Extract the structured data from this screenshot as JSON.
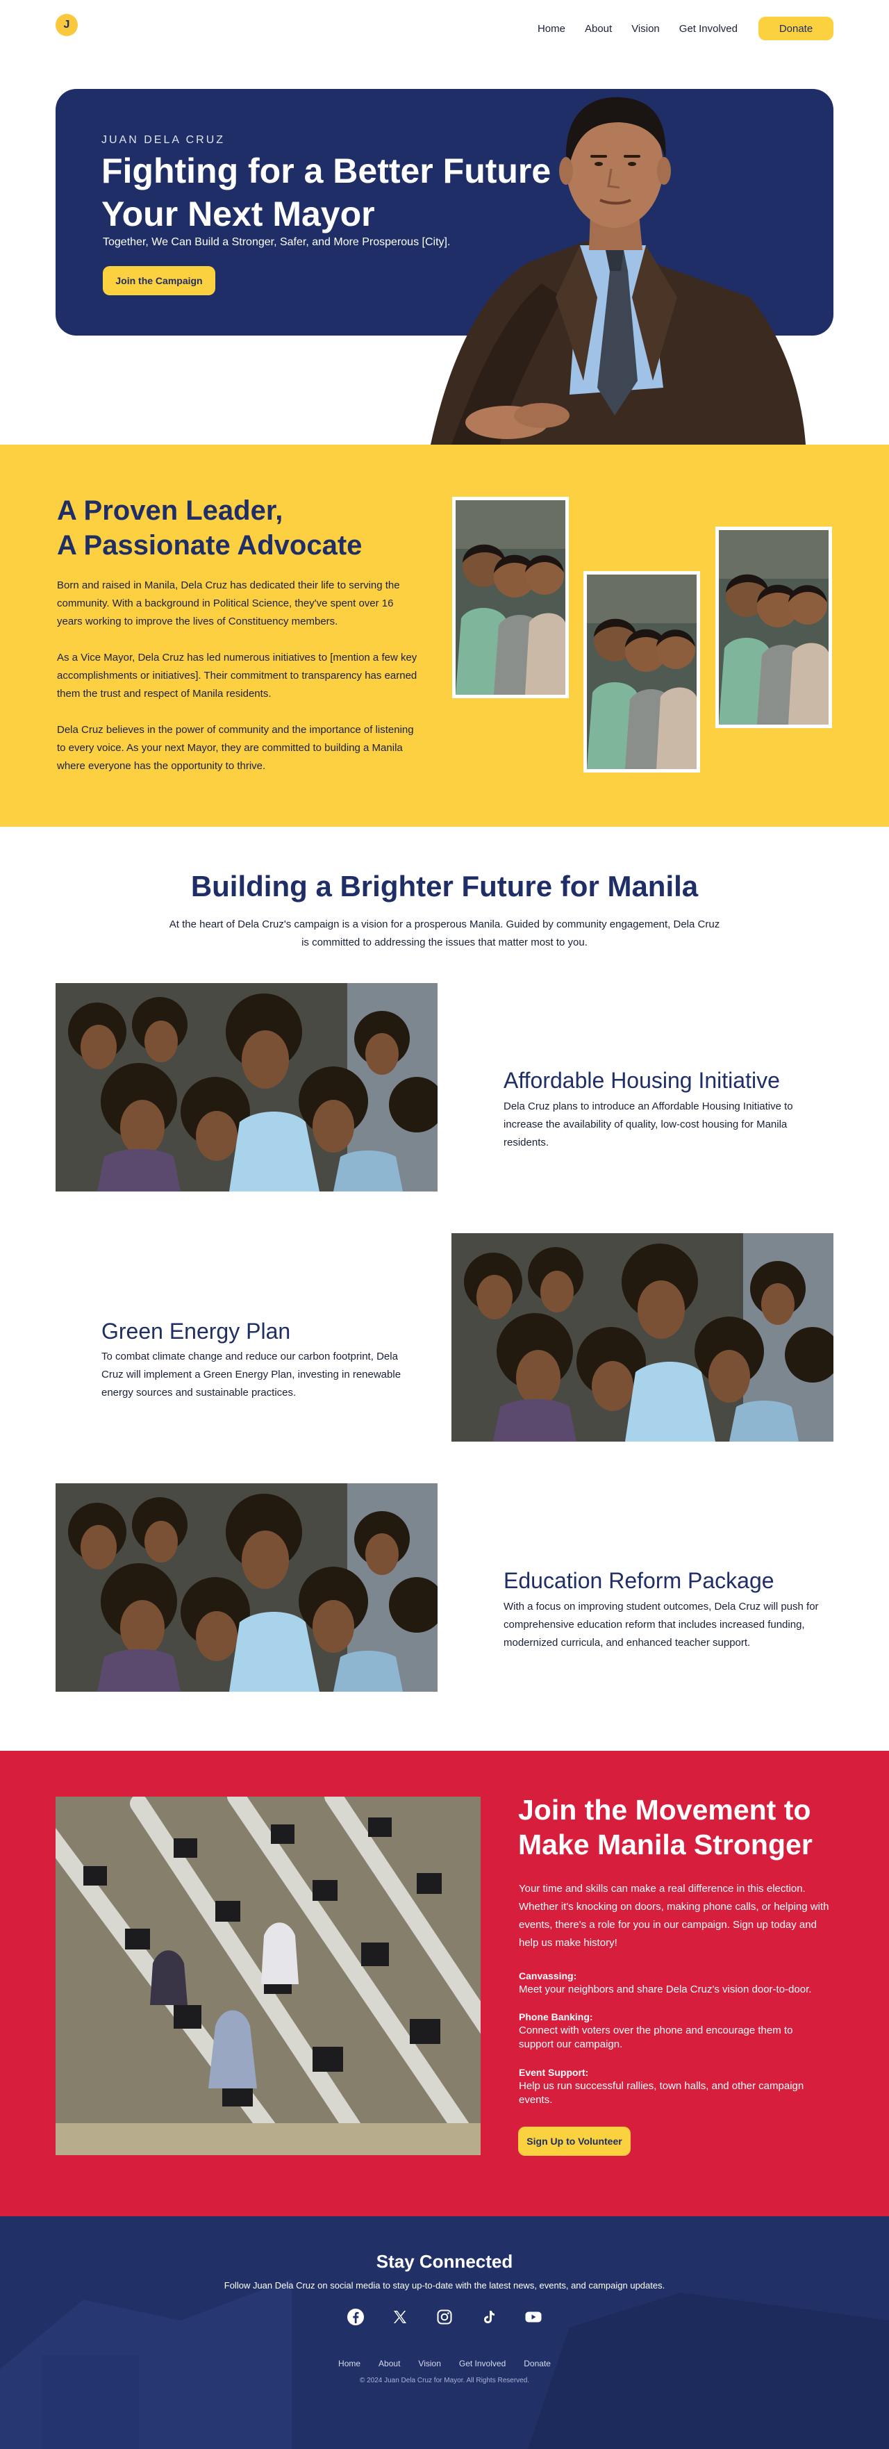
{
  "colors": {
    "navy": "#1f2e66",
    "yellow": "#fcd040",
    "red": "#d81e3d",
    "white": "#ffffff"
  },
  "nav": {
    "logo_letter": "J",
    "links": [
      "Home",
      "About",
      "Vision",
      "Get Involved"
    ],
    "donate_label": "Donate"
  },
  "hero": {
    "kicker": "JUAN DELA CRUZ",
    "title": "Fighting for a Better Future as Your Next Mayor",
    "subtitle": "Together, We Can Build a Stronger, Safer, and More Prosperous [City].",
    "cta_label": "Join the Campaign"
  },
  "about": {
    "title_line1": "A Proven Leader,",
    "title_line2": "A Passionate Advocate",
    "paragraphs": [
      "Born and raised in Manila, Dela Cruz has dedicated their life to serving the community. With a background in Political Science, they've spent over 16 years working to improve the lives of Constituency members.",
      "As a Vice Mayor, Dela Cruz has led numerous initiatives to [mention a few key accomplishments or initiatives]. Their commitment to transparency has earned them the trust and respect of Manila residents.",
      "Dela Cruz believes in the power of community and the importance of listening to every voice. As your next Mayor, they are committed to building a Manila where everyone has the opportunity to thrive."
    ]
  },
  "vision": {
    "title": "Building a Brighter Future for Manila",
    "intro": "At the heart of Dela Cruz's campaign is a vision for a prosperous Manila. Guided by community engagement, Dela Cruz is committed to addressing the issues that matter most to you.",
    "items": [
      {
        "title": "Affordable Housing Initiative",
        "text": "Dela Cruz plans to introduce an Affordable Housing Initiative to increase the availability of quality, low-cost housing for Manila residents."
      },
      {
        "title": "Green Energy Plan",
        "text": "To combat climate change and reduce our carbon footprint, Dela Cruz will implement a Green Energy Plan, investing in renewable energy sources and sustainable practices."
      },
      {
        "title": "Education Reform Package",
        "text": "With a focus on improving student outcomes, Dela Cruz will push for comprehensive education reform that includes increased funding, modernized curricula, and enhanced teacher support."
      }
    ]
  },
  "volunteer": {
    "title": "Join the Movement to Make Manila Stronger",
    "intro": "Your time and skills can make a real difference in this election. Whether it's knocking on doors, making phone calls, or helping with events, there's a role for you in our campaign. Sign up today and help us make history!",
    "roles": [
      {
        "title": "Canvassing:",
        "text": "Meet your neighbors and share Dela Cruz's vision door-to-door."
      },
      {
        "title": "Phone Banking:",
        "text": "Connect with voters over the phone and encourage them to support our campaign."
      },
      {
        "title": "Event Support:",
        "text": "Help us run successful rallies, town halls, and other campaign events."
      }
    ],
    "cta_label": "Sign Up to Volunteer"
  },
  "footer": {
    "title": "Stay Connected",
    "subtitle": "Follow Juan Dela Cruz on social media to stay up-to-date with the latest news, events, and campaign updates.",
    "socials": [
      "facebook-icon",
      "x-icon",
      "instagram-icon",
      "tiktok-icon",
      "youtube-icon"
    ],
    "links": [
      "Home",
      "About",
      "Vision",
      "Get Involved",
      "Donate"
    ],
    "copyright": "© 2024 Juan Dela Cruz for Mayor. All Rights Reserved."
  }
}
